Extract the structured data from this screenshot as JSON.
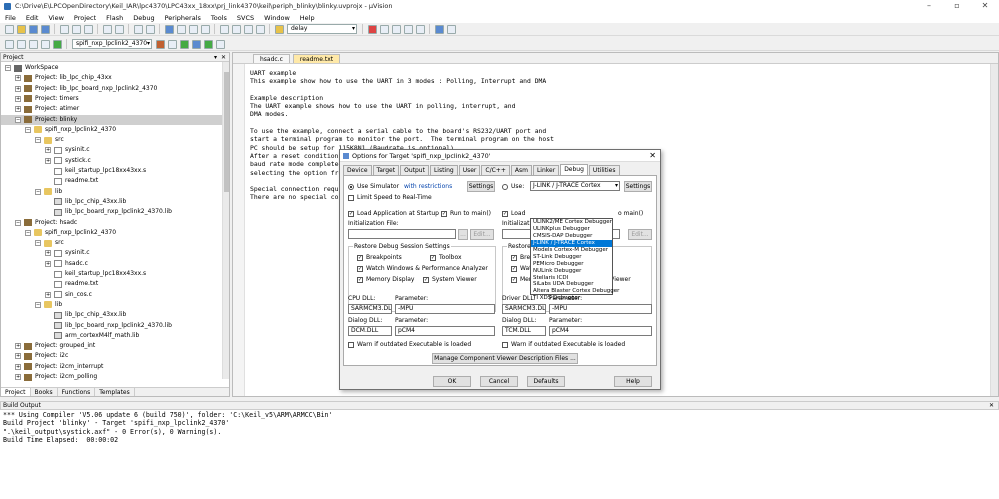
{
  "window": {
    "title": "C:\\Drive\\E\\LPCOpenDirectory\\Keil_IAR\\lpc4370\\LPC43xx_18xx\\prj_link4370\\keil\\periph_blinky\\blinky.uvprojx - µVision"
  },
  "menu": [
    "File",
    "Edit",
    "View",
    "Project",
    "Flash",
    "Debug",
    "Peripherals",
    "Tools",
    "SVCS",
    "Window",
    "Help"
  ],
  "toolbar": {
    "find_value": "delay",
    "target_value": "spifi_nxp_lpclink2_4370"
  },
  "project_panel": {
    "title": "Project",
    "tree": [
      {
        "label": "WorkSpace",
        "depth": 0,
        "icon": "ws",
        "exp": "-"
      },
      {
        "label": "Project: lib_lpc_chip_43xx",
        "depth": 1,
        "icon": "proj",
        "exp": "+"
      },
      {
        "label": "Project: lib_lpc_board_nxp_lpclink2_4370",
        "depth": 1,
        "icon": "proj",
        "exp": "+"
      },
      {
        "label": "Project: timers",
        "depth": 1,
        "icon": "proj",
        "exp": "+"
      },
      {
        "label": "Project: atimer",
        "depth": 1,
        "icon": "proj",
        "exp": "+"
      },
      {
        "label": "Project: blinky",
        "depth": 1,
        "icon": "proj",
        "exp": "-",
        "sel": true
      },
      {
        "label": "spifi_nxp_lpclink2_4370",
        "depth": 2,
        "icon": "fold",
        "exp": "-"
      },
      {
        "label": "src",
        "depth": 3,
        "icon": "fold",
        "exp": "-"
      },
      {
        "label": "sysinit.c",
        "depth": 4,
        "icon": "file",
        "exp": "+"
      },
      {
        "label": "systick.c",
        "depth": 4,
        "icon": "file",
        "exp": "+"
      },
      {
        "label": "keil_startup_lpc18xx43xx.s",
        "depth": 4,
        "icon": "file",
        "exp": ""
      },
      {
        "label": "readme.txt",
        "depth": 4,
        "icon": "file",
        "exp": ""
      },
      {
        "label": "lib",
        "depth": 3,
        "icon": "fold",
        "exp": "-"
      },
      {
        "label": "lib_lpc_chip_43xx.lib",
        "depth": 4,
        "icon": "lib",
        "exp": ""
      },
      {
        "label": "lib_lpc_board_nxp_lpclink2_4370.lib",
        "depth": 4,
        "icon": "lib",
        "exp": ""
      },
      {
        "label": "Project: hsadc",
        "depth": 1,
        "icon": "proj",
        "exp": "-"
      },
      {
        "label": "spifi_nxp_lpclink2_4370",
        "depth": 2,
        "icon": "fold",
        "exp": "-"
      },
      {
        "label": "src",
        "depth": 3,
        "icon": "fold",
        "exp": "-"
      },
      {
        "label": "sysinit.c",
        "depth": 4,
        "icon": "file",
        "exp": "+"
      },
      {
        "label": "hsadc.c",
        "depth": 4,
        "icon": "file",
        "exp": "+"
      },
      {
        "label": "keil_startup_lpc18xx43xx.s",
        "depth": 4,
        "icon": "file",
        "exp": ""
      },
      {
        "label": "readme.txt",
        "depth": 4,
        "icon": "file",
        "exp": ""
      },
      {
        "label": "sin_cos.c",
        "depth": 4,
        "icon": "file",
        "exp": "+"
      },
      {
        "label": "lib",
        "depth": 3,
        "icon": "fold",
        "exp": "-"
      },
      {
        "label": "lib_lpc_chip_43xx.lib",
        "depth": 4,
        "icon": "lib",
        "exp": ""
      },
      {
        "label": "lib_lpc_board_nxp_lpclink2_4370.lib",
        "depth": 4,
        "icon": "lib",
        "exp": ""
      },
      {
        "label": "arm_cortexM4lf_math.lib",
        "depth": 4,
        "icon": "lib",
        "exp": ""
      },
      {
        "label": "Project: grouped_int",
        "depth": 1,
        "icon": "proj",
        "exp": "+"
      },
      {
        "label": "Project: i2c",
        "depth": 1,
        "icon": "proj",
        "exp": "+"
      },
      {
        "label": "Project: i2cm_interrupt",
        "depth": 1,
        "icon": "proj",
        "exp": "+"
      },
      {
        "label": "Project: i2cm_polling",
        "depth": 1,
        "icon": "proj",
        "exp": "+"
      }
    ],
    "tabs": [
      "Project",
      "Books",
      "Functions",
      "Templates"
    ]
  },
  "editor": {
    "tabs": [
      "hsadc.c",
      "readme.txt"
    ],
    "lines": [
      "UART example",
      "This example show how to use the UART in 3 modes : Polling, Interrupt and DMA",
      "",
      "Example description",
      "The UART example shows how to use the UART in polling, interrupt, and",
      "DMA modes.",
      "",
      "To use the example, connect a serial cable to the board's RS232/UART port and",
      "start a terminal program to monitor the port.  The terminal program on the host",
      "PC should be setup for 115K8N1 (Baudrate is optional).",
      "After a reset condition,",
      "baud rate mode completed",
      "selecting the option fro",
      "",
      "Special connection requi",
      "There are no special con"
    ]
  },
  "build_output": {
    "title": "Build Output",
    "lines": [
      "*** Using Compiler 'V5.06 update 6 (build 750)', folder: 'C:\\Keil_v5\\ARM\\ARMCC\\Bin'",
      "Build Project 'blinky' - Target 'spifi_nxp_lpclink2_4370'",
      "\".\\keil_output\\systick.axf\" - 0 Error(s), 0 Warning(s).",
      "Build Time Elapsed:  00:00:02"
    ]
  },
  "dialog": {
    "title": "Options for Target 'spifi_nxp_lpclink2_4370'",
    "tabs": [
      "Device",
      "Target",
      "Output",
      "Listing",
      "User",
      "C/C++",
      "Asm",
      "Linker",
      "Debug",
      "Utilities"
    ],
    "left": {
      "use_simulator": "Use Simulator",
      "with_restrictions": "with restrictions",
      "settings": "Settings",
      "limit_speed": "Limit Speed to Real-Time",
      "load_app": "Load Application at Startup",
      "run_main": "Run to main()",
      "init_file_label": "Initialization File:",
      "ellipsis": "...",
      "edit": "Edit...",
      "restore_group": "Restore Debug Session Settings",
      "breakpoints": "Breakpoints",
      "toolbox": "Toolbox",
      "watch": "Watch Windows & Performance Analyzer",
      "memory": "Memory Display",
      "sysviewer": "System Viewer",
      "cpu_dll_label": "CPU DLL:",
      "param_label": "Parameter:",
      "cpu_dll": "SARMCM3.DLL",
      "cpu_param": "-MPU",
      "dialog_dll_label": "Dialog DLL:",
      "dialog_dll": "DCM.DLL",
      "dialog_param": "pCM4",
      "warn": "Warn if outdated Executable is loaded"
    },
    "right": {
      "use": "Use:",
      "debugger": "J-LINK / J-TRACE Cortex",
      "settings": "Settings",
      "load_short": "Load",
      "run_main_short": "o main()",
      "init_short": "Initializatio",
      "edit": "Edit...",
      "restore_short": "Restore",
      "bre_short": "Bre",
      "watch_short": "Watch Windows",
      "memory": "Memory Display",
      "sysviewer": "System Viewer",
      "driver_dll_label": "Driver DLL:",
      "param_label": "Parameter:",
      "driver_dll": "SARMCM3.DLL",
      "driver_param": "-MPU",
      "dialog_dll_label": "Dialog DLL:",
      "dialog_dll": "TCM.DLL",
      "dialog_param": "pCM4",
      "warn": "Warn if outdated Executable is loaded"
    },
    "dropdown_options": [
      "ULINK2/ME Cortex Debugger",
      "ULINKplus Debugger",
      "CMSIS-DAP Debugger",
      "J-LINK / J-TRACE Cortex",
      "Models Cortex-M Debugger",
      "ST-Link Debugger",
      "PEMicro Debugger",
      "NULink Debugger",
      "Stellaris ICDI",
      "SiLabs UDA Debugger",
      "Altera Blaster Cortex Debugger",
      "TI XDS Debugger"
    ],
    "manage_button": "Manage Component Viewer Description Files ...",
    "ok": "OK",
    "cancel": "Cancel",
    "defaults": "Defaults",
    "help": "Help"
  }
}
